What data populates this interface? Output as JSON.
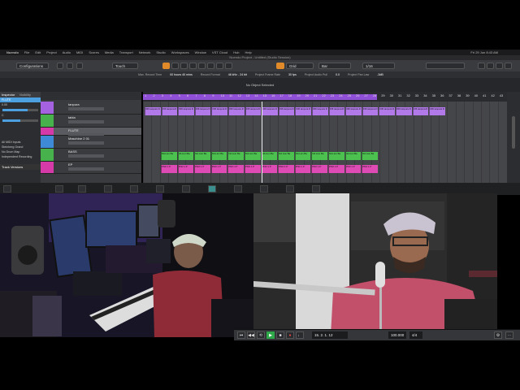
{
  "menubar": {
    "items": [
      "Nuendo",
      "File",
      "Edit",
      "Project",
      "Audio",
      "MIDI",
      "Scores",
      "Media",
      "Transport",
      "Network",
      "Studio",
      "Workspaces",
      "Window",
      "VST Cloud",
      "Hub",
      "Help"
    ],
    "clock": "Fri 29 Jun 8:43 AM"
  },
  "window_title": "Nuendo Project - Untitled (Studio Session)",
  "toolbar": {
    "configurations": "Configurations",
    "touch": "Touch",
    "grid": "Grid",
    "bar": "Bar",
    "quantize": "1/16"
  },
  "infoline": {
    "items": [
      "Max. Record Time",
      "00 hours 40 mins",
      "Record Format",
      "48 kHz - 24 bit",
      "Project Frame Rate",
      "30 fps",
      "Project Audio Pull",
      "0.0",
      "Project Pan Law",
      "-3dB"
    ]
  },
  "selection_info": "No Object Selected",
  "inspector": {
    "tab_inspector": "Inspector",
    "tab_visibility": "Visibility",
    "track_name": "FLUTE",
    "midi_inputs": "All MIDI Inputs",
    "routing": "Steinberg Grand",
    "no_drum_map": "No Drum Map",
    "independent_recording": "Independent Recording",
    "track_versions": "Track Versions",
    "volume_value": "0.00",
    "pan_value": "C"
  },
  "tracks": [
    {
      "name": "tanpura",
      "color": "#a562e0"
    },
    {
      "name": "tabla",
      "color": "#47b14b"
    },
    {
      "name": "FLUTE",
      "color": "#d63aa8"
    },
    {
      "name": "Maschine 2 01",
      "color": "#3f8ad6"
    },
    {
      "name": "BASS",
      "color": "#47b14b"
    },
    {
      "name": "EP",
      "color": "#d63aa8"
    }
  ],
  "ruler_marks": [
    "1",
    "2",
    "3",
    "4",
    "5",
    "6",
    "7",
    "8",
    "9",
    "10",
    "11",
    "12",
    "13",
    "14",
    "15",
    "16",
    "17",
    "18",
    "19",
    "20",
    "21",
    "22",
    "23",
    "24",
    "25",
    "26",
    "27",
    "28",
    "29",
    "30",
    "31",
    "32",
    "33",
    "34",
    "35",
    "36",
    "37",
    "38",
    "39",
    "40",
    "41",
    "42",
    "43"
  ],
  "parts": {
    "tanpura_label": "036 tanpura D",
    "bass_label": "NA Lion Ba",
    "ep_label": "PNO 1 P"
  },
  "transport": {
    "position": "15. 2. 1. 12",
    "tempo": "100.000",
    "signature": "4/4"
  }
}
